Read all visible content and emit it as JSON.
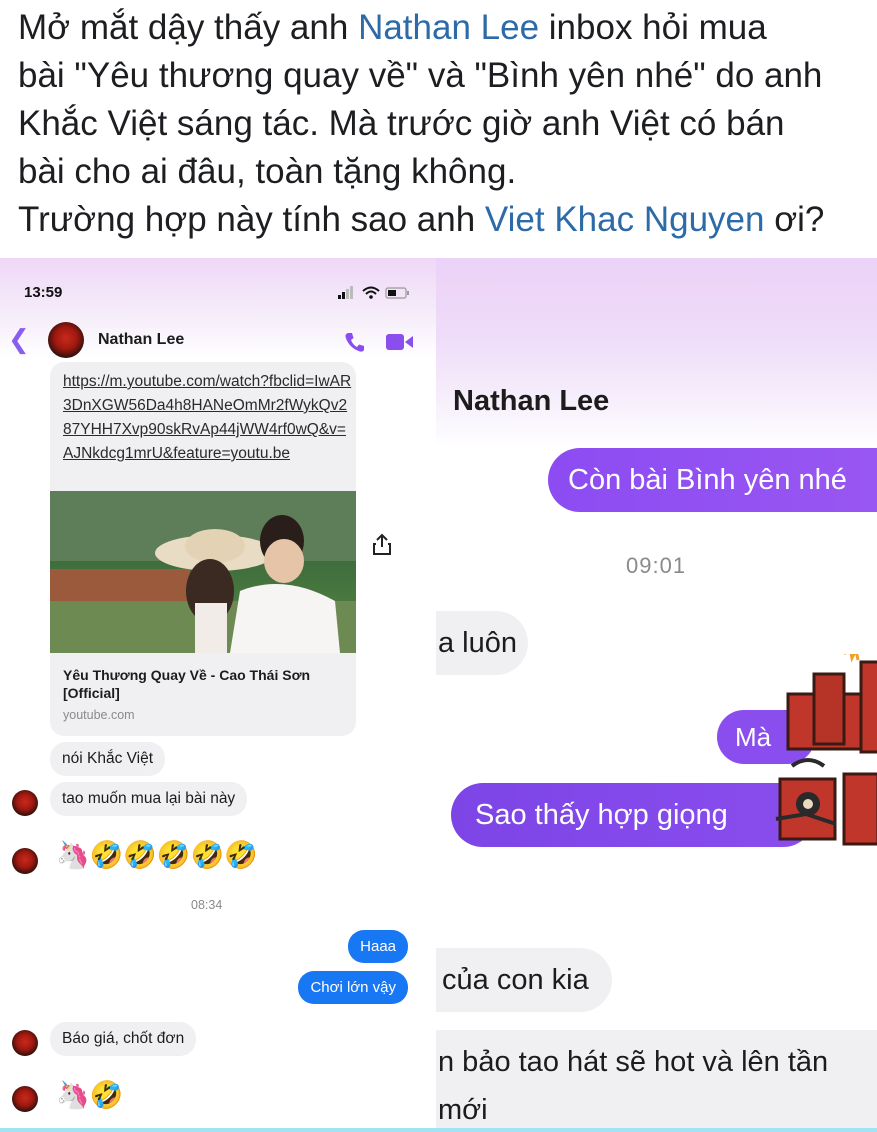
{
  "caption": {
    "line1_a": "Mở mắt dậy thấy anh ",
    "line1_tag": "Nathan Lee",
    "line1_b": " inbox hỏi mua",
    "line2": "bài \"Yêu thương quay về\" và \"Bình yên nhé\" do anh",
    "line3": "Khắc Việt sáng tác. Mà trước giờ anh Việt có bán",
    "line4": "bài cho ai đâu, toàn tặng không.",
    "line5_a": "Trường hợp này tính sao anh ",
    "line5_tag": "Viet Khac Nguyen",
    "line5_b": " ơi?"
  },
  "left": {
    "status_time": "13:59",
    "contact_name": "Nathan Lee",
    "link_url": "https://m.youtube.com/watch?fbclid=IwAR3DnXGW56Da4h8HANeOmMr2fWykQv287YHH7Xvp90skRvAp44jWW4rf0wQ&v=AJNkdcg1mrU&feature=youtu.be",
    "link_title": "Yêu Thương Quay Về - Cao Thái Sơn [Official]",
    "link_domain": "youtube.com",
    "msg1": "nói Khắc Việt",
    "msg2": "tao muốn mua lại bài này",
    "emoji_row1": "🦄🤣🤣🤣🤣🤣",
    "timestamp": "08:34",
    "sent1": "Haaa",
    "sent2": "Chơi lớn vậy",
    "msg3": "Báo giá, chốt đơn",
    "emoji_row2": "🦄🤣"
  },
  "right": {
    "contact_name": "Nathan Lee",
    "bubble1": "Còn bài Bình yên nhé",
    "timestamp": "09:01",
    "grey1": "a luôn",
    "purple_small": "Mà",
    "purple2": "Sao thấy hợp giọng",
    "grey2": "của con kia",
    "grey3": "n bảo tao hát sẽ hot và lên tần",
    "grey4": "mới"
  },
  "colors": {
    "messenger_purple": "#8a4dee",
    "messenger_blue": "#1877f2",
    "tag_blue": "#2d6aa8"
  },
  "icons": [
    "back-icon",
    "avatar",
    "phone-icon",
    "video-icon",
    "share-icon",
    "signal-icon",
    "wifi-icon",
    "battery-icon",
    "sticker"
  ]
}
